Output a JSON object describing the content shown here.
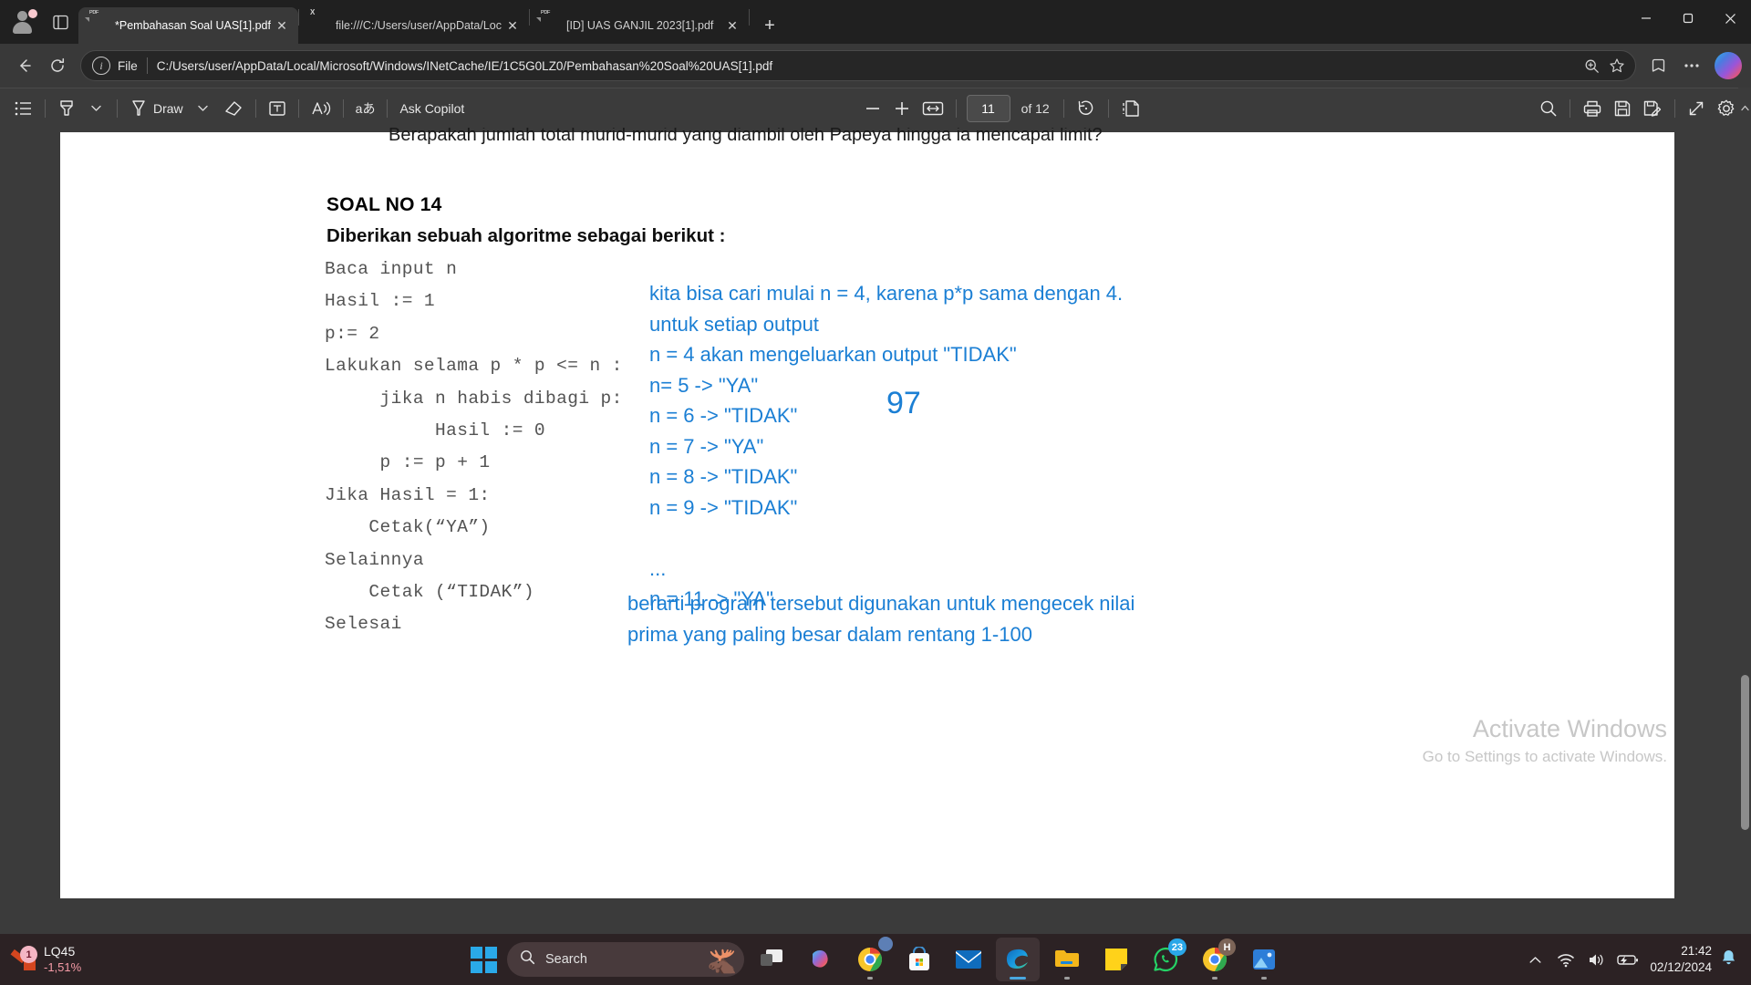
{
  "browser": {
    "tabs": [
      {
        "title": "*Pembahasan Soal UAS[1].pdf",
        "icon": "pdf-file-icon",
        "active": true
      },
      {
        "title": "file:///C:/Users/user/AppData/Loc",
        "icon": "excel-file-icon",
        "active": false
      },
      {
        "title": "[ID] UAS GANJIL 2023[1].pdf",
        "icon": "pdf-file-icon",
        "active": false
      }
    ],
    "new_tab_label": "+",
    "close_label": "✕",
    "window_controls": {
      "minimize": "–",
      "maximize": "❐",
      "close": "✕"
    },
    "address_bar": {
      "scheme_label": "File",
      "url": "C:/Users/user/AppData/Local/Microsoft/Windows/INetCache/IE/1C5G0LZ0/Pembahasan%20Soal%20UAS[1].pdf"
    },
    "nav": {
      "back": "back-arrow-icon",
      "refresh": "refresh-icon"
    }
  },
  "pdf_toolbar": {
    "toc_label": "table-of-contents-icon",
    "highlight_label": "highlight-icon",
    "draw_label": "Draw",
    "erase_label": "eraser-icon",
    "text_label": "add-text-icon",
    "read_aloud_label": "read-aloud-icon",
    "translate_label": "aあ",
    "copilot_label": "Ask Copilot",
    "zoom_out_label": "−",
    "zoom_in_label": "+",
    "fit_label": "fit-to-width-icon",
    "page_current": "11",
    "page_of": "of 12",
    "rotate_label": "rotate-icon",
    "layout_label": "page-layout-icon",
    "search_label": "search-icon",
    "print_label": "print-icon",
    "save_label": "save-icon",
    "save_as_label": "save-as-icon",
    "fullscreen_label": "fullscreen-icon",
    "settings_label": "settings-gear-icon"
  },
  "document": {
    "clipped_top_line": "Berapakah jumlah total murid-murid yang diambil oleh Papeya hingga ia mencapai limit?",
    "heading": "SOAL NO 14",
    "subheading": "Diberikan sebuah algoritme sebagai berikut :",
    "code": "Baca input n\nHasil := 1\np:= 2\nLakukan selama p * p <= n :\n     jika n habis dibagi p:\n          Hasil := 0\n     p := p + 1\nJika Hasil = 1:\n    Cetak(“YA”)\nSelainnya\n    Cetak (“TIDAK”)\nSelesai",
    "annotation_color": "#1b7fd4",
    "annotation_main": "kita bisa cari mulai n = 4, karena p*p sama dengan 4.\nuntuk setiap output\nn = 4 akan mengeluarkan output \"TIDAK\"\nn= 5 -> \"YA\"\nn = 6 -> \"TIDAK\"\nn = 7 -> \"YA\"\nn = 8 -> \"TIDAK\"\nn = 9 -> \"TIDAK\"\n\n...\nn = 11 -> \"YA\"",
    "annotation_number": "97",
    "annotation_bottom": "berarti program tersebut digunakan untuk mengecek nilai\nprima yang paling besar dalam rentang 1-100",
    "watermark_title": "Activate Windows",
    "watermark_sub": "Go to Settings to activate Windows."
  },
  "taskbar": {
    "stock": {
      "name": "LQ45",
      "change": "-1,51%",
      "badge": "1"
    },
    "start_label": "windows-start-icon",
    "search_placeholder": "Search",
    "apps": [
      {
        "name": "task-view",
        "badge": ""
      },
      {
        "name": "copilot",
        "badge": ""
      },
      {
        "name": "chrome",
        "badge": ""
      },
      {
        "name": "microsoft-store",
        "badge": ""
      },
      {
        "name": "mail",
        "badge": ""
      },
      {
        "name": "microsoft-edge",
        "badge": ""
      },
      {
        "name": "file-explorer",
        "badge": ""
      },
      {
        "name": "sticky-notes",
        "badge": ""
      },
      {
        "name": "whatsapp",
        "badge": "23"
      },
      {
        "name": "chrome-profile",
        "badge": ""
      },
      {
        "name": "photos",
        "badge": ""
      }
    ],
    "tray": {
      "chevron": "show-hidden-icons",
      "wifi": "wifi-icon",
      "volume": "volume-icon",
      "battery": "battery-icon",
      "time": "21:42",
      "date": "02/12/2024",
      "notification": "notification-bell-icon"
    }
  }
}
